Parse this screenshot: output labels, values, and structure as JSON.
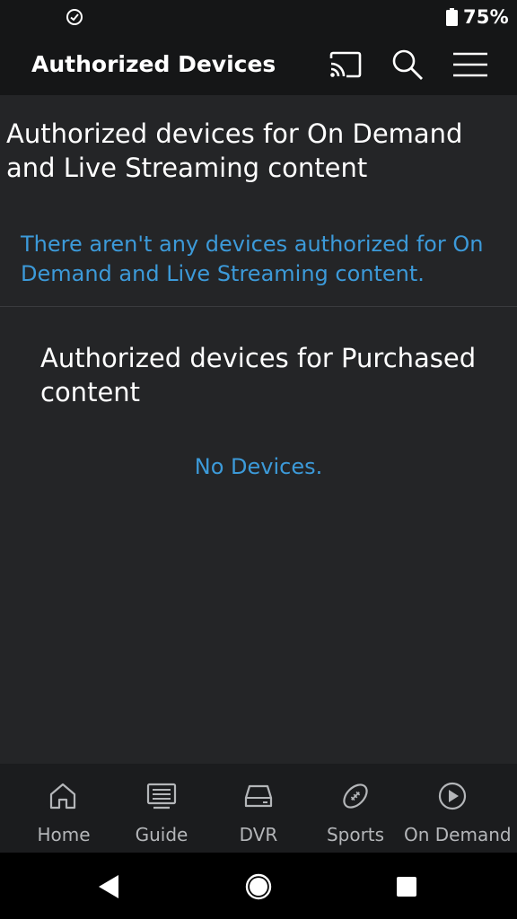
{
  "status_bar": {
    "left_icon": "check-circle-icon",
    "battery_icon": "battery-icon",
    "battery_text": "75%"
  },
  "app_bar": {
    "title": "Authorized Devices",
    "icons": [
      "cast-icon",
      "search-icon",
      "menu-icon"
    ]
  },
  "sections": {
    "streaming": {
      "heading": "Authorized devices for On Demand and Live Streaming content",
      "empty_message": "There aren't any devices authorized for On Demand and Live Streaming content."
    },
    "purchased": {
      "heading": "Authorized devices for Purchased content",
      "empty_message": "No Devices."
    }
  },
  "bottom_nav": {
    "items": [
      {
        "label": "Home",
        "icon": "home-icon"
      },
      {
        "label": "Guide",
        "icon": "guide-icon"
      },
      {
        "label": "DVR",
        "icon": "dvr-icon"
      },
      {
        "label": "Sports",
        "icon": "football-icon"
      },
      {
        "label": "On Demand",
        "icon": "play-circle-icon"
      }
    ]
  },
  "system_nav": {
    "buttons": [
      "back-icon",
      "home-circle-icon",
      "recents-icon"
    ]
  },
  "colors": {
    "background": "#242527",
    "bar": "#151617",
    "accent": "#3c9ad9",
    "nav_label": "#b4b6b9"
  }
}
